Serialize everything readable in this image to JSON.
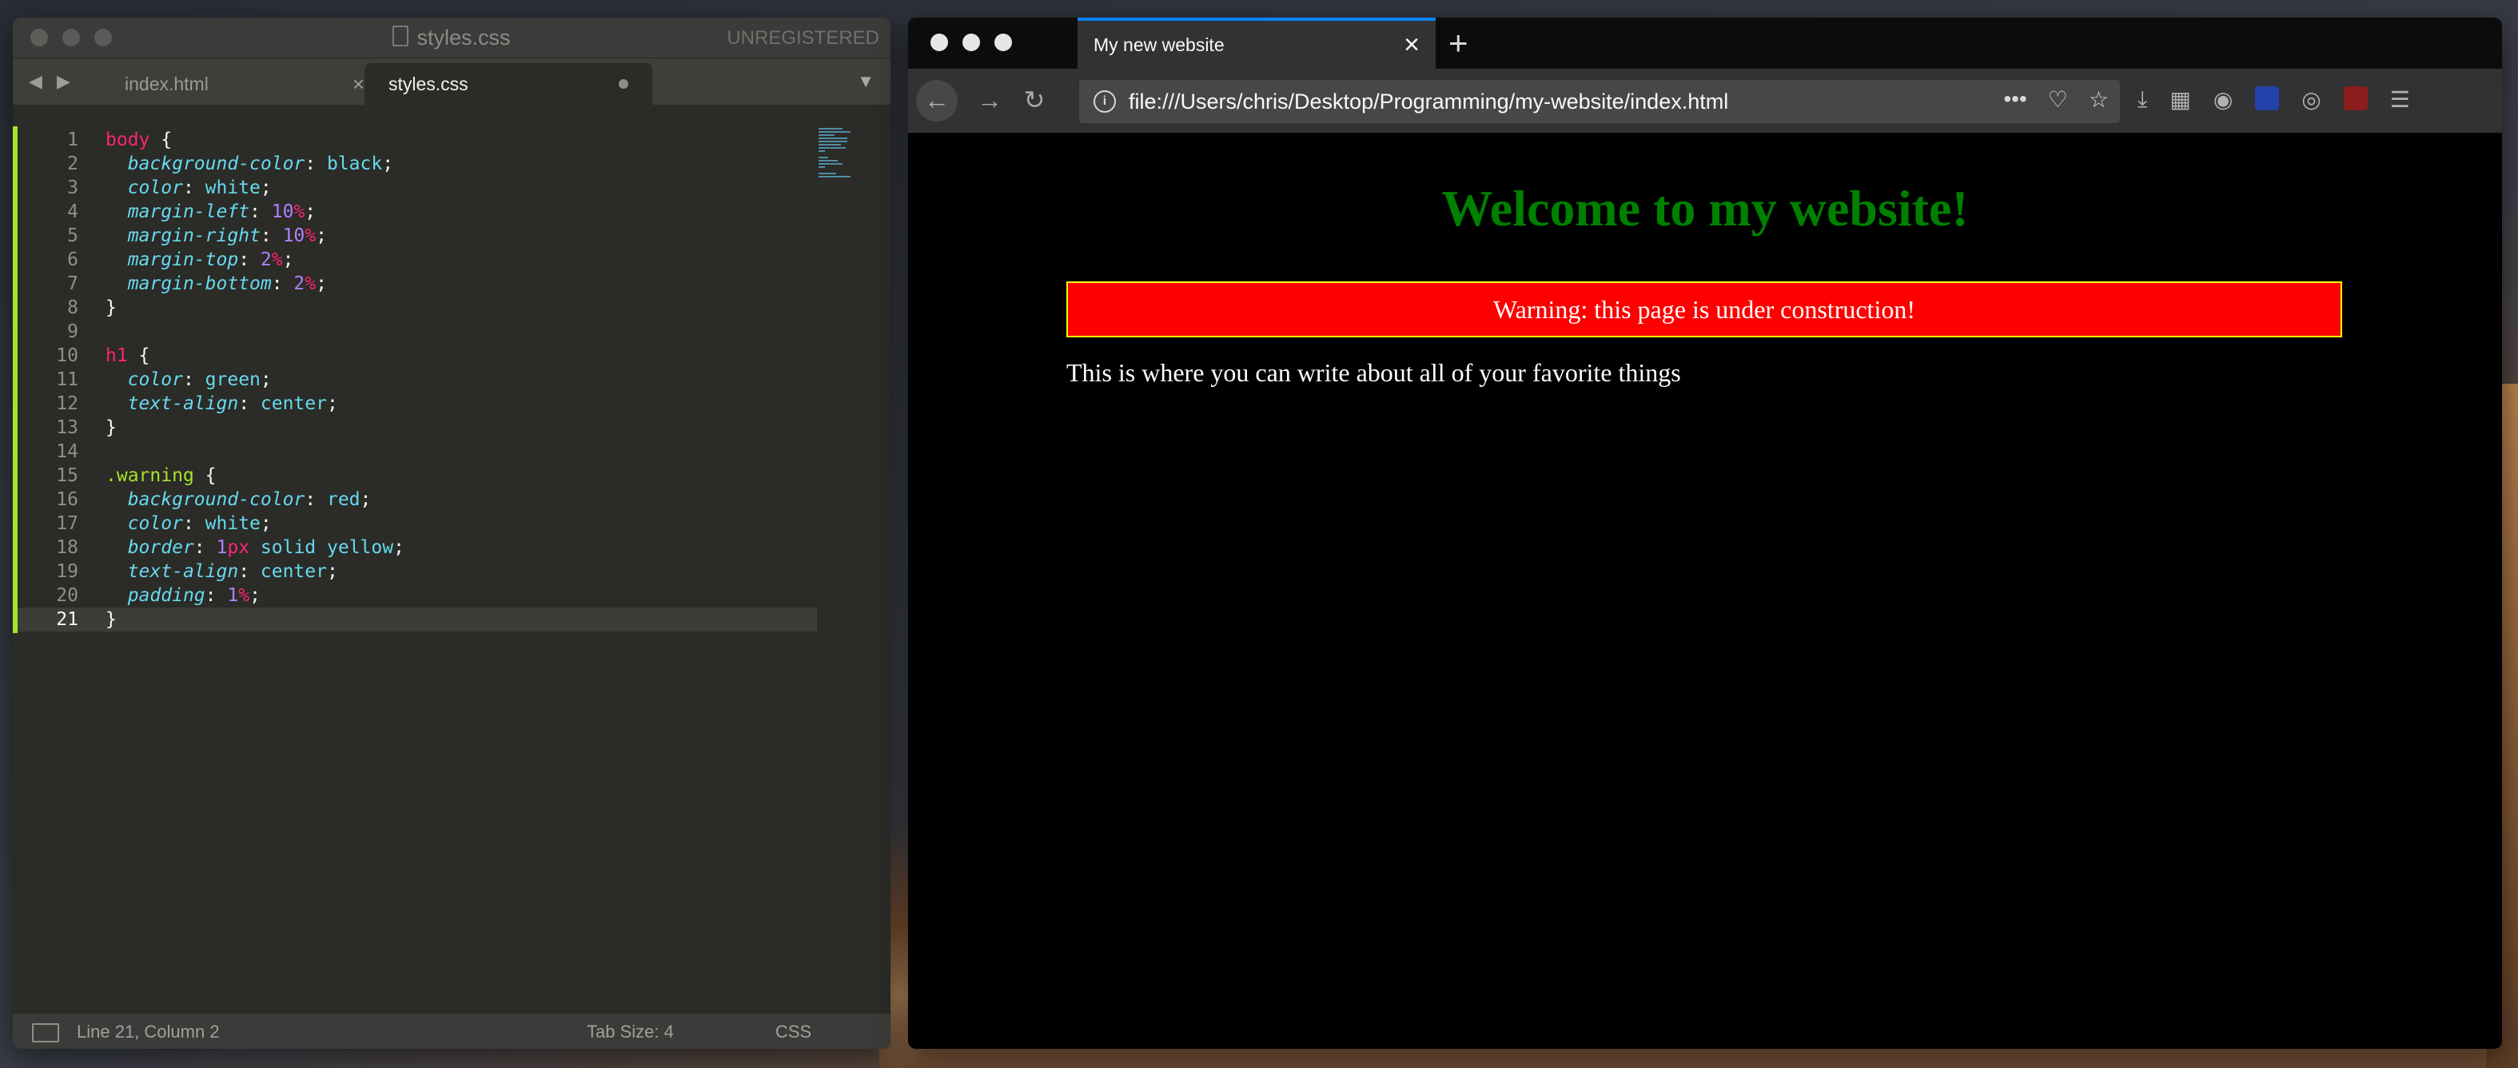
{
  "sublime": {
    "title": "styles.css",
    "unregistered": "UNREGISTERED",
    "tabs": [
      {
        "label": "index.html",
        "active": false
      },
      {
        "label": "styles.css",
        "active": true
      }
    ],
    "line_numbers": [
      "1",
      "2",
      "3",
      "4",
      "5",
      "6",
      "7",
      "8",
      "9",
      "10",
      "11",
      "12",
      "13",
      "14",
      "15",
      "16",
      "17",
      "18",
      "19",
      "20",
      "21"
    ],
    "status": {
      "position": "Line 21, Column 2",
      "tab_size": "Tab Size: 4",
      "syntax": "CSS"
    }
  },
  "firefox": {
    "tab_title": "My new website",
    "url": "file:///Users/chris/Desktop/Programming/my-website/index.html",
    "page": {
      "heading": "Welcome to my website!",
      "warning": "Warning: this page is under construction!",
      "paragraph": "This is where you can write about all of your favorite things"
    }
  },
  "colors": {
    "heading": "#008000",
    "warning_bg": "#ff0000",
    "warning_border": "#ffff00",
    "tab_accent": "#0a84ff"
  }
}
